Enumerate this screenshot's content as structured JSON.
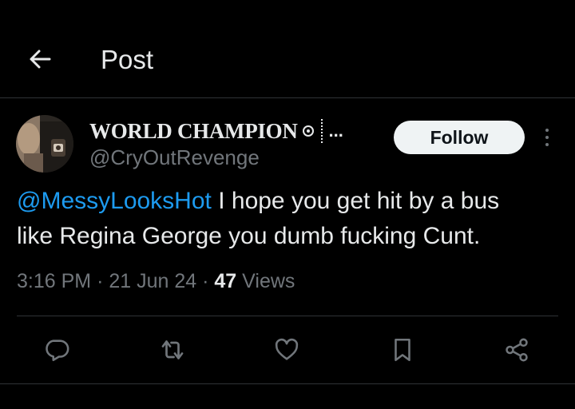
{
  "header": {
    "title": "Post"
  },
  "author": {
    "display_name": "WORLD CHAMPION",
    "name_more": "...",
    "handle": "@CryOutRevenge",
    "follow_label": "Follow"
  },
  "tweet": {
    "mention": "@MessyLooksHot",
    "text_line1": " I hope you get hit by a bus",
    "text_line2": "like Regina George you dumb fucking Cunt.",
    "time": "3:16 PM",
    "date": "21 Jun 24",
    "views_count": "47",
    "views_label": "Views"
  },
  "actions": [
    "reply-icon",
    "repost-icon",
    "like-icon",
    "bookmark-icon",
    "share-icon"
  ],
  "colors": {
    "background": "#000000",
    "text": "#e7e9ea",
    "muted": "#71767b",
    "link": "#1d9bf0",
    "divider": "#2f3336"
  }
}
